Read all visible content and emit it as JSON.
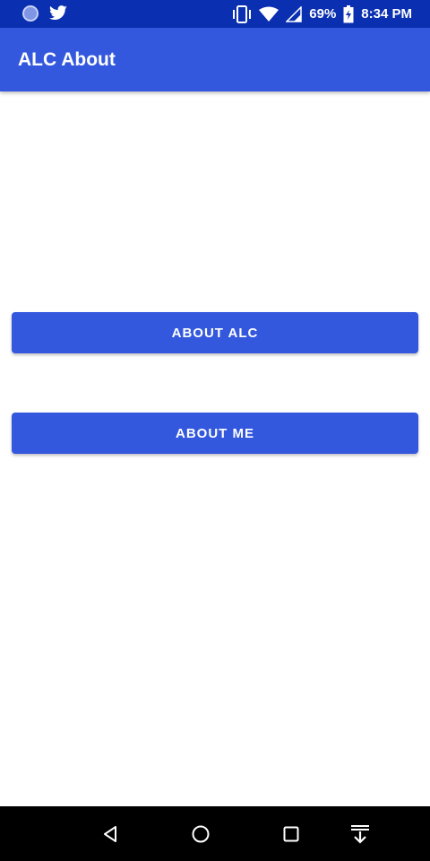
{
  "status_bar": {
    "battery": "69%",
    "time": "8:34 PM",
    "left_icons": [
      "circle-notification-icon",
      "twitter-icon"
    ],
    "right_icons": [
      "vibrate-icon",
      "wifi-icon",
      "signal-icon",
      "battery-charging-icon"
    ]
  },
  "app_bar": {
    "title": "ALC About"
  },
  "buttons": {
    "about_alc": "ABOUT ALC",
    "about_me": "ABOUT ME"
  },
  "nav_bar": {
    "icons": [
      "back-icon",
      "home-icon",
      "recents-icon",
      "notification-pull-icon"
    ]
  },
  "colors": {
    "status_bar": "#0a2fb0",
    "primary": "#3358de",
    "background": "#ffffff",
    "nav_bar": "#000000"
  }
}
